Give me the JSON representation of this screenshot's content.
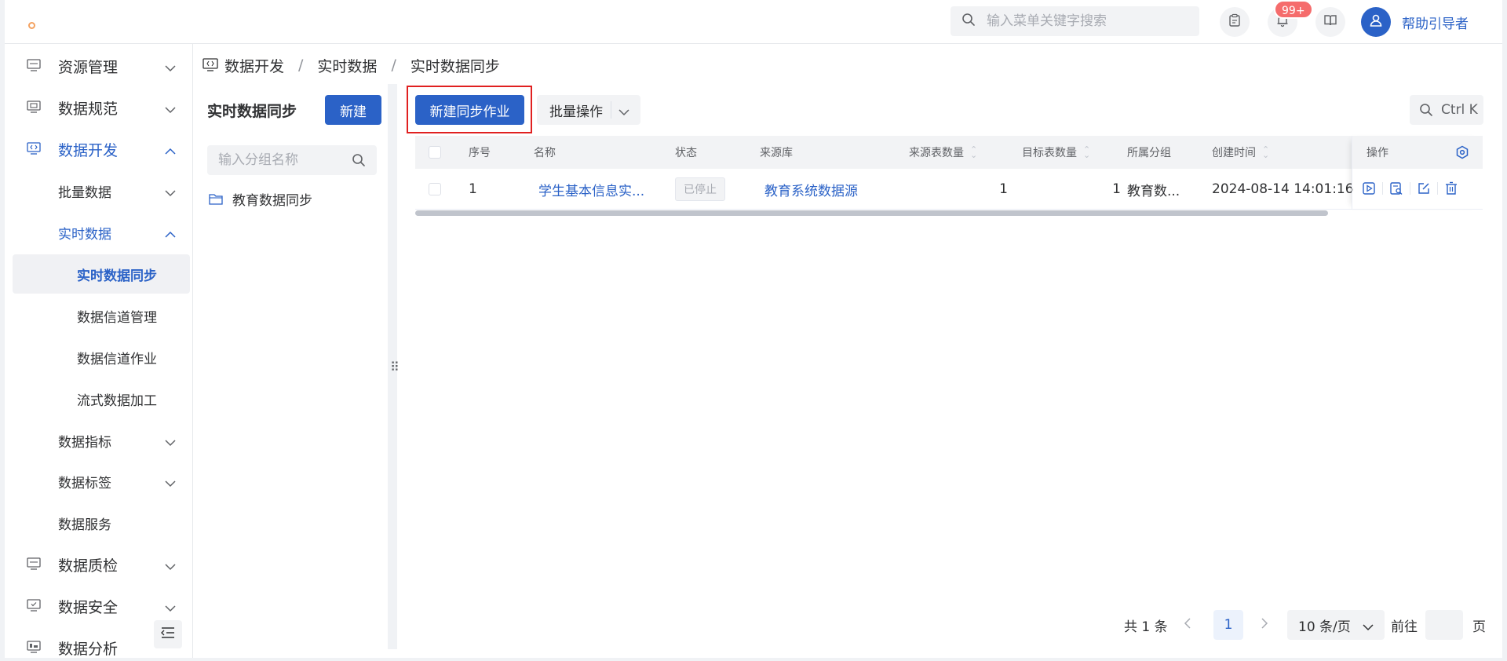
{
  "header": {
    "search_placeholder": "输入菜单关键字搜索",
    "notification_badge": "99+",
    "username": "帮助引导者"
  },
  "sidebar": {
    "items": [
      {
        "label": "资源管理"
      },
      {
        "label": "数据规范"
      },
      {
        "label": "数据开发"
      },
      {
        "label": "批量数据"
      },
      {
        "label": "实时数据"
      },
      {
        "label": "实时数据同步"
      },
      {
        "label": "数据信道管理"
      },
      {
        "label": "数据信道作业"
      },
      {
        "label": "流式数据加工"
      },
      {
        "label": "数据指标"
      },
      {
        "label": "数据标签"
      },
      {
        "label": "数据服务"
      },
      {
        "label": "数据质检"
      },
      {
        "label": "数据安全"
      },
      {
        "label": "数据分析"
      }
    ]
  },
  "breadcrumb": {
    "items": [
      "数据开发",
      "实时数据",
      "实时数据同步"
    ],
    "separator": "/"
  },
  "group_panel": {
    "title": "实时数据同步",
    "new_button": "新建",
    "search_placeholder": "输入分组名称",
    "groups": [
      "教育数据同步"
    ]
  },
  "toolbar": {
    "new_job_button": "新建同步作业",
    "batch_button": "批量操作",
    "search_shortcut": "Ctrl K"
  },
  "table": {
    "columns": {
      "seq": "序号",
      "name": "名称",
      "status": "状态",
      "source_db": "来源库",
      "source_count": "来源表数量",
      "target_count": "目标表数量",
      "group": "所属分组",
      "created": "创建时间",
      "ops": "操作"
    },
    "rows": [
      {
        "seq": "1",
        "name": "学生基本信息实...",
        "status": "已停止",
        "source_db": "教育系统数据源",
        "source_count": "1",
        "target_count": "1",
        "group": "教育数...",
        "created": "2024-08-14 14:01:16"
      }
    ]
  },
  "pagination": {
    "total": "共 1 条",
    "current": "1",
    "page_size": "10 条/页",
    "goto_label": "前往",
    "page_suffix": "页"
  },
  "colors": {
    "primary": "#2b62c7",
    "highlight_border": "#e02020",
    "badge": "#f56c6c"
  }
}
